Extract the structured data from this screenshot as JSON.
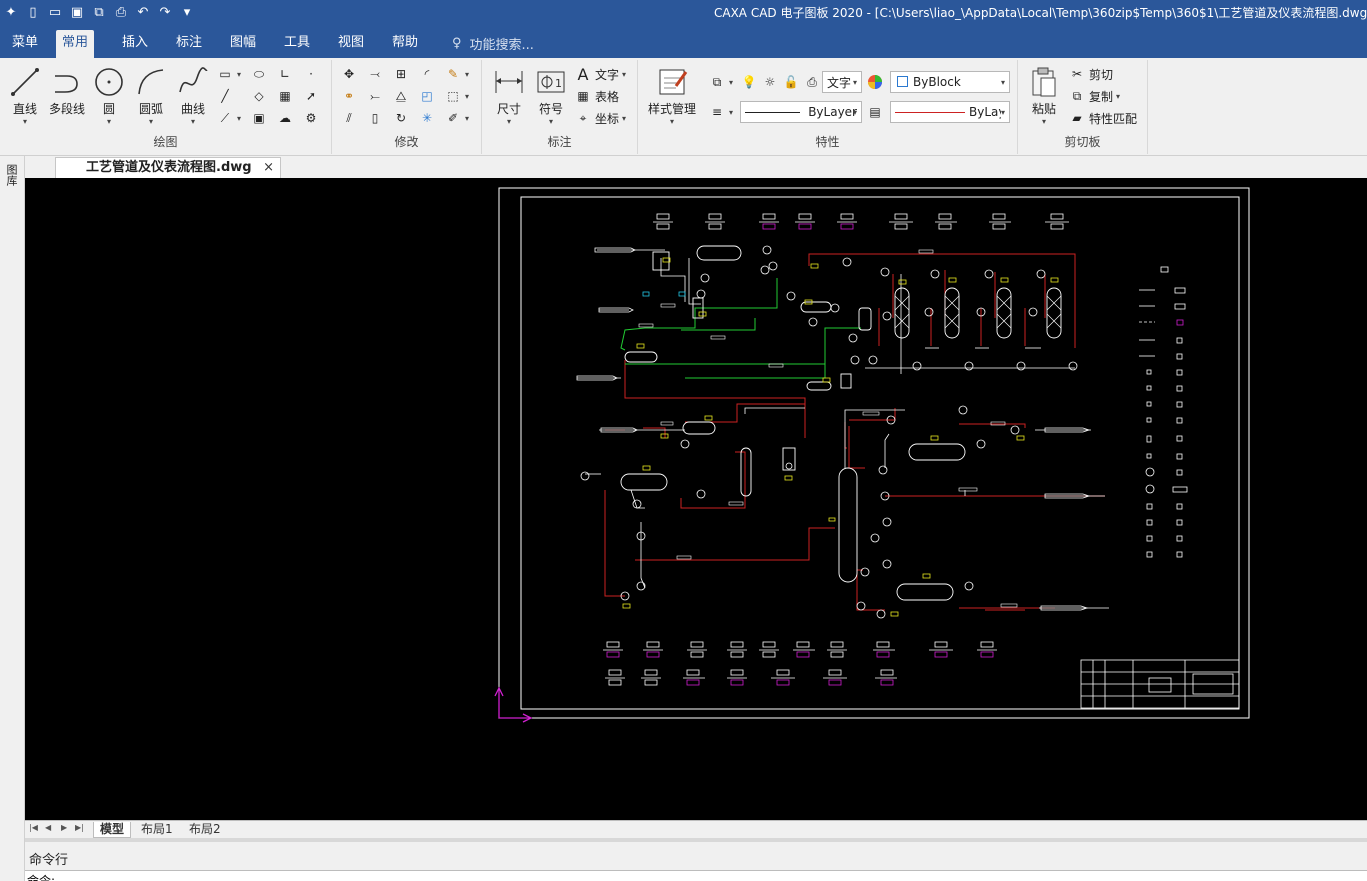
{
  "window": {
    "title": "CAXA CAD 电子图板 2020 - [C:\\Users\\liao_\\AppData\\Local\\Temp\\360zip$Temp\\360$1\\工艺管道及仪表流程图.dwg]"
  },
  "menu_tabs": [
    "菜单",
    "常用",
    "插入",
    "标注",
    "图幅",
    "工具",
    "视图",
    "帮助"
  ],
  "search": {
    "placeholder": "功能搜索..."
  },
  "ribbon": {
    "draw": {
      "label": "绘图",
      "line": "直线",
      "polyline": "多段线",
      "circle": "圆",
      "arc": "圆弧",
      "curve": "曲线"
    },
    "modify": {
      "label": "修改"
    },
    "annotate": {
      "label": "标注",
      "dimension": "尺寸",
      "symbol": "符号",
      "text": "文字",
      "table": "表格",
      "coord": "坐标"
    },
    "properties": {
      "label": "特性",
      "style_manager": "样式管理",
      "text_style": "文字",
      "color": "ByBlock",
      "linetype": "ByLayer",
      "lineweight": "ByLayer"
    },
    "clipboard": {
      "label": "剪切板",
      "paste": "粘贴",
      "cut": "剪切",
      "copy": "复制",
      "match": "特性匹配"
    }
  },
  "document": {
    "tab": "工艺管道及仪表流程图.dwg",
    "close": "×"
  },
  "sidebar": {
    "label": "图库"
  },
  "layouts": [
    "模型",
    "布局1",
    "布局2"
  ],
  "command": {
    "title": "命令行",
    "prompt": "命令:"
  },
  "colors": {
    "accent": "#2b579a",
    "canvas": "#000000",
    "red_line": "#cc2222",
    "green_line": "#22cc33",
    "magenta": "#dd22dd",
    "yellow": "#e8e820"
  }
}
